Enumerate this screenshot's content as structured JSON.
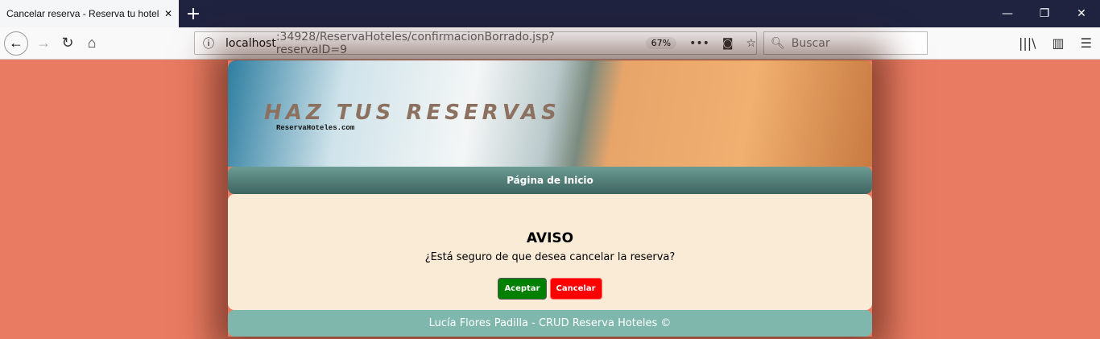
{
  "browser": {
    "tab_title": "Cancelar reserva - Reserva tu hotel",
    "url_host": "localhost",
    "url_rest": ":34928/ReservaHoteles/confirmacionBorrado.jsp?reservaID=9",
    "zoom": "67%",
    "search_placeholder": "Buscar"
  },
  "banner": {
    "title": "HAZ TUS RESERVAS",
    "subtitle": "ReservaHoteles.com"
  },
  "menu": {
    "home": "Página de Inicio"
  },
  "dialog": {
    "title": "AVISO",
    "message": "¿Está seguro de que desea cancelar la reserva?",
    "accept": "Aceptar",
    "cancel": "Cancelar"
  },
  "footer": {
    "text": "Lucía Flores Padilla - CRUD Reserva Hoteles ©"
  },
  "colors": {
    "background": "#e87b62",
    "accept": "#008000",
    "cancel": "#ff0000",
    "footer": "#7fb7ad"
  }
}
